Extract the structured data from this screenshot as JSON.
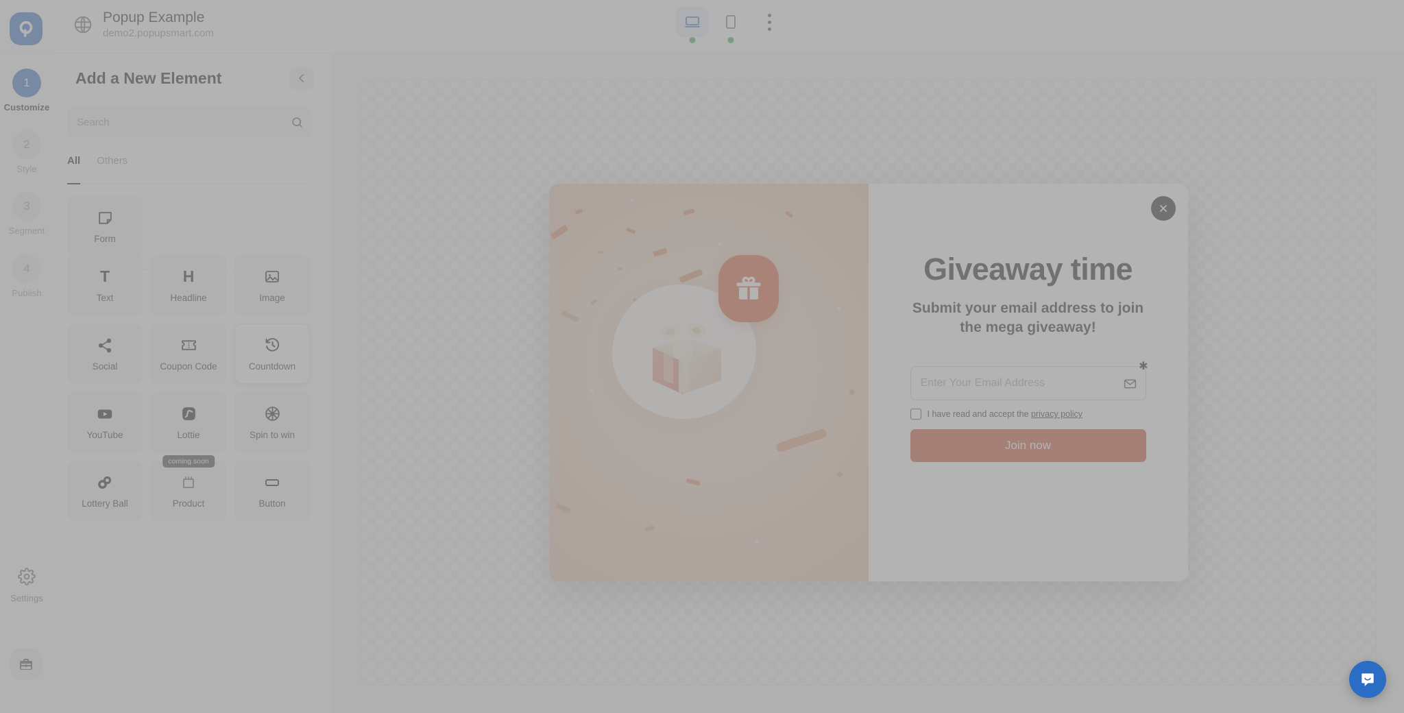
{
  "app": {
    "logo_icon": "popupsmart-logo-icon"
  },
  "topbar": {
    "globe_icon": "globe-icon",
    "site_title": "Popup Example",
    "site_url": "demo2.popupsmart.com",
    "devices": [
      {
        "name": "desktop",
        "icon": "desktop-icon",
        "active": true,
        "status_dot": "#3ba552"
      },
      {
        "name": "mobile",
        "icon": "mobile-icon",
        "active": false,
        "status_dot": "#3ba552"
      }
    ],
    "more_icon": "kebab-menu-icon"
  },
  "rail": {
    "steps": [
      {
        "number": "1",
        "label": "Customize",
        "active": true
      },
      {
        "number": "2",
        "label": "Style",
        "active": false
      },
      {
        "number": "3",
        "label": "Segment",
        "active": false
      },
      {
        "number": "4",
        "label": "Publish",
        "active": false
      }
    ],
    "settings_label": "Settings",
    "settings_icon": "gear-icon",
    "briefcase_icon": "briefcase-icon"
  },
  "panel": {
    "title": "Add a New Element",
    "back_icon": "arrow-left-icon",
    "search": {
      "placeholder": "Search",
      "value": "",
      "icon": "search-icon"
    },
    "tabs": [
      {
        "label": "All",
        "active": true
      },
      {
        "label": "Others",
        "active": false
      }
    ],
    "primary_group": [
      {
        "label": "Form",
        "icon": "form-icon",
        "selected": false,
        "badge": ""
      }
    ],
    "elements": [
      {
        "label": "Text",
        "icon": "text-icon",
        "glyph": "T",
        "selected": false,
        "badge": ""
      },
      {
        "label": "Headline",
        "icon": "headline-icon",
        "glyph": "H",
        "selected": false,
        "badge": ""
      },
      {
        "label": "Image",
        "icon": "image-icon",
        "glyph": "",
        "selected": false,
        "badge": ""
      },
      {
        "label": "Social",
        "icon": "share-icon",
        "glyph": "",
        "selected": false,
        "badge": ""
      },
      {
        "label": "Coupon Code",
        "icon": "ticket-icon",
        "glyph": "",
        "selected": false,
        "badge": ""
      },
      {
        "label": "Countdown",
        "icon": "history-clock-icon",
        "glyph": "",
        "selected": true,
        "badge": ""
      },
      {
        "label": "YouTube",
        "icon": "youtube-icon",
        "glyph": "",
        "selected": false,
        "badge": ""
      },
      {
        "label": "Lottie",
        "icon": "lottie-icon",
        "glyph": "",
        "selected": false,
        "badge": ""
      },
      {
        "label": "Spin to win",
        "icon": "spin-wheel-icon",
        "glyph": "",
        "selected": false,
        "badge": ""
      },
      {
        "label": "Lottery Ball",
        "icon": "lottery-ball-icon",
        "glyph": "",
        "selected": false,
        "badge": ""
      },
      {
        "label": "Product",
        "icon": "product-icon",
        "glyph": "",
        "selected": false,
        "badge": "coming soon"
      },
      {
        "label": "Button",
        "icon": "button-icon",
        "glyph": "",
        "selected": false,
        "badge": ""
      }
    ]
  },
  "popup": {
    "close_icon": "close-icon",
    "gift_badge_icon": "gift-icon",
    "gift_image": "gift-box-3d-illustration",
    "headline": "Giveaway time",
    "subheadline": "Submit your email address to join the mega giveaway!",
    "email": {
      "placeholder": "Enter Your Email Address",
      "value": "",
      "icon": "envelope-icon",
      "required_marker": "✱"
    },
    "consent": {
      "checked": false,
      "text_before": "I have read and accept the ",
      "link_text": "privacy policy"
    },
    "cta_label": "Join now",
    "accent_color": "#cc4a24",
    "badge_color": "#d9552a",
    "image_bg_color": "#ecd0ba"
  },
  "chat": {
    "icon": "chat-bubble-icon",
    "color": "#2b6cc4"
  }
}
